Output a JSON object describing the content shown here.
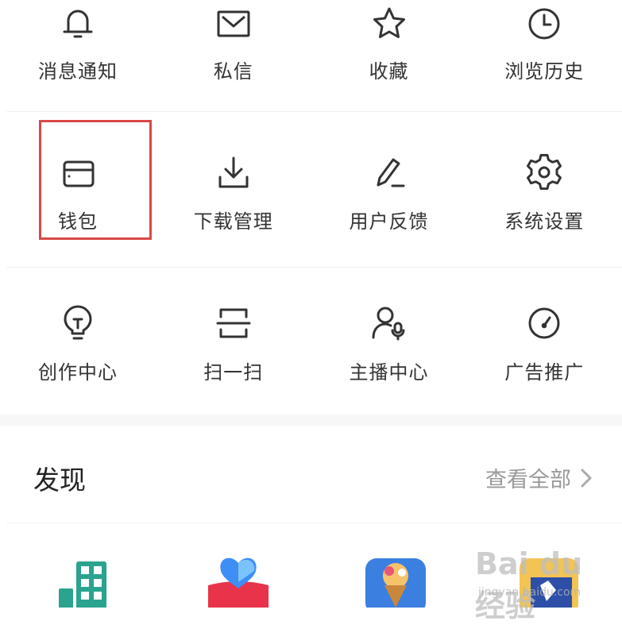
{
  "grid": {
    "row1": [
      {
        "label": "消息通知",
        "icon": "bell-icon"
      },
      {
        "label": "私信",
        "icon": "envelope-icon"
      },
      {
        "label": "收藏",
        "icon": "star-icon"
      },
      {
        "label": "浏览历史",
        "icon": "clock-icon"
      }
    ],
    "row2": [
      {
        "label": "钱包",
        "icon": "wallet-icon"
      },
      {
        "label": "下载管理",
        "icon": "download-icon"
      },
      {
        "label": "用户反馈",
        "icon": "pen-icon"
      },
      {
        "label": "系统设置",
        "icon": "gear-icon"
      }
    ],
    "row3": [
      {
        "label": "创作中心",
        "icon": "lightbulb-icon"
      },
      {
        "label": "扫一扫",
        "icon": "scan-icon"
      },
      {
        "label": "主播中心",
        "icon": "anchor-user-icon"
      },
      {
        "label": "广告推广",
        "icon": "gauge-icon"
      }
    ]
  },
  "highlight_color": "#d94848",
  "discover": {
    "title": "发现",
    "see_all": "查看全部"
  },
  "watermark": {
    "brand": "Bai du 经验",
    "url": "jingyan.baidu.com"
  }
}
